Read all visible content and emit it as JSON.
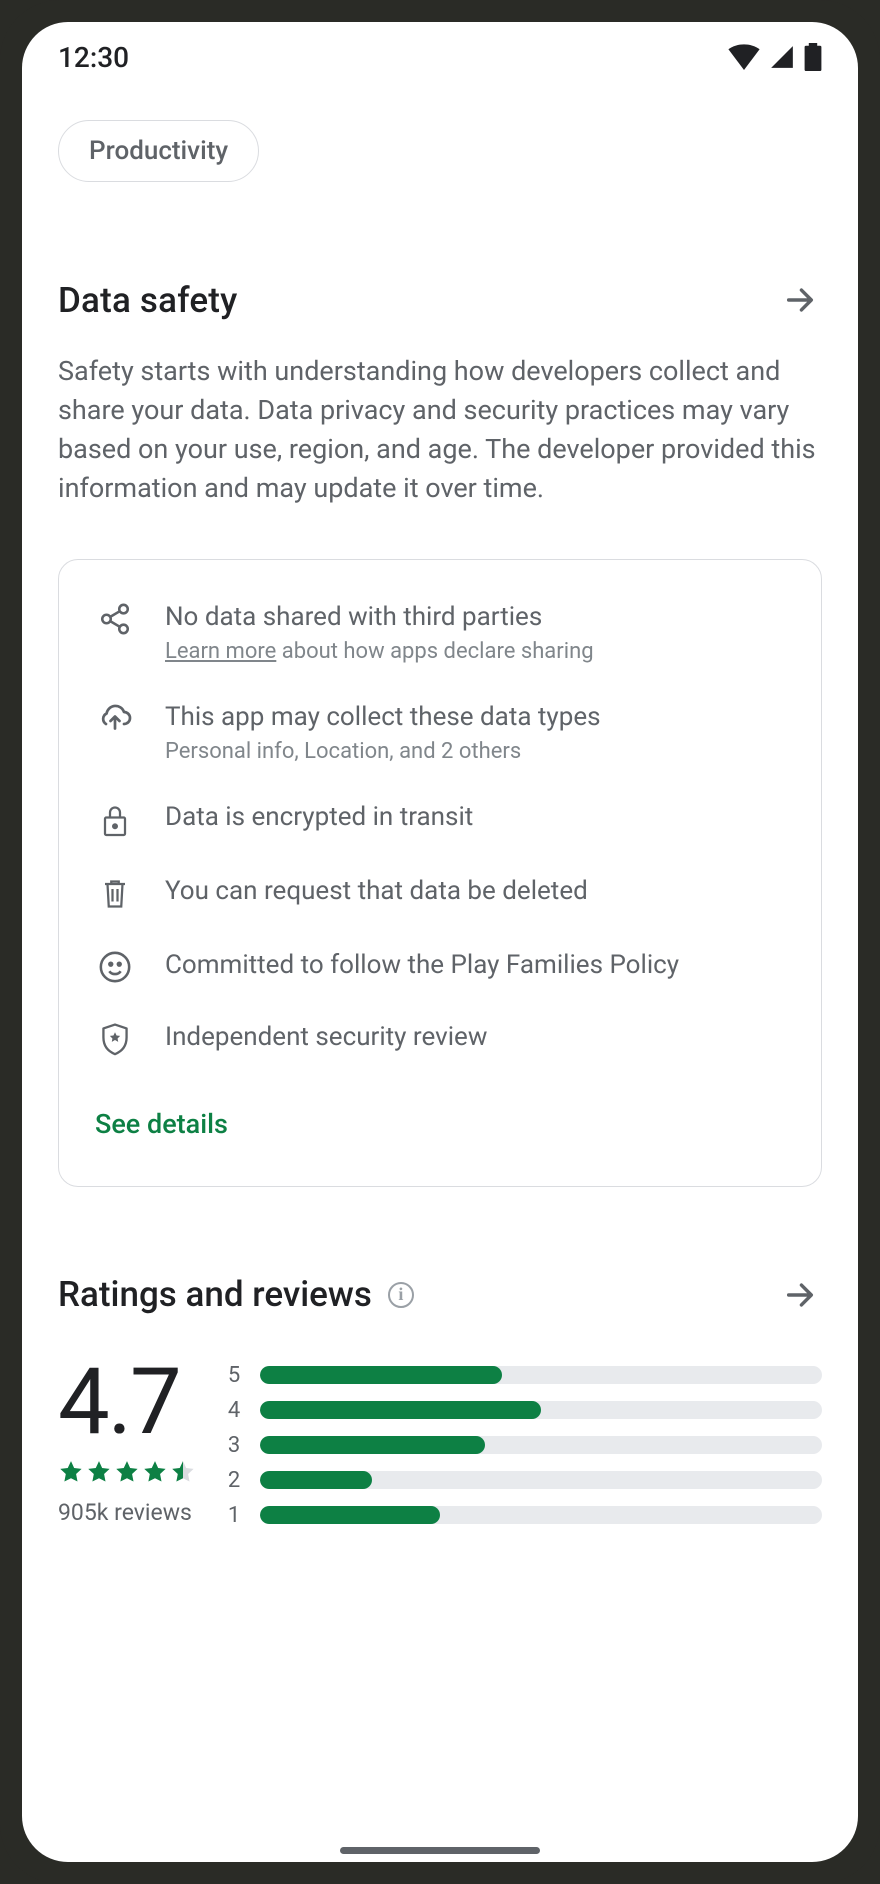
{
  "status": {
    "time": "12:30"
  },
  "chip": {
    "label": "Productivity"
  },
  "data_safety": {
    "title": "Data safety",
    "description": "Safety starts with understanding how developers collect and share your data. Data privacy and security practices may vary based on your use, region, and age. The developer provided this information and may update it over time.",
    "items": [
      {
        "icon": "share-icon",
        "line1": "No data shared with third parties",
        "learn_more": "Learn more",
        "line2_tail": " about how apps declare sharing"
      },
      {
        "icon": "cloud-icon",
        "line1": "This app may collect these data types",
        "line2": "Personal info, Location, and 2 others"
      },
      {
        "icon": "lock-icon",
        "line1": "Data is encrypted in transit"
      },
      {
        "icon": "trash-icon",
        "line1": "You can request that data be deleted"
      },
      {
        "icon": "smiley-icon",
        "line1": "Committed to follow the Play Families Policy"
      },
      {
        "icon": "shield-icon",
        "line1": "Independent security review"
      }
    ],
    "see_details": "See details"
  },
  "ratings": {
    "title": "Ratings and reviews",
    "score": "4.7",
    "stars": 4.5,
    "review_count": "905k  reviews",
    "bars": [
      {
        "label": "5",
        "pct": 43
      },
      {
        "label": "4",
        "pct": 50
      },
      {
        "label": "3",
        "pct": 40
      },
      {
        "label": "2",
        "pct": 20
      },
      {
        "label": "1",
        "pct": 32
      }
    ]
  },
  "colors": {
    "accent": "#0d8044"
  }
}
